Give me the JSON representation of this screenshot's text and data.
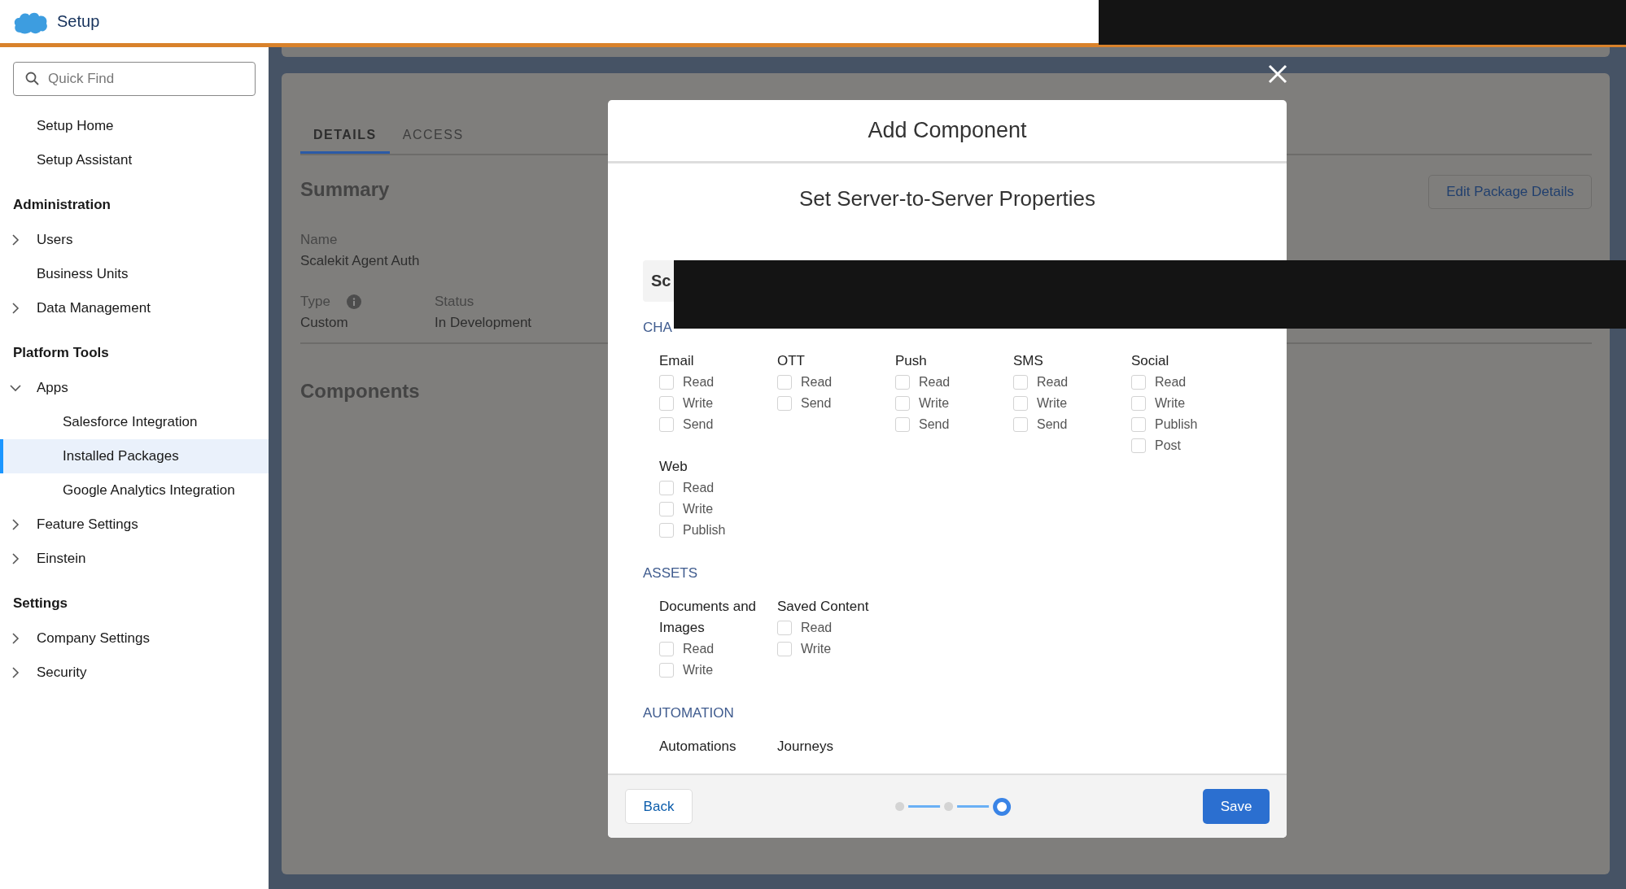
{
  "header": {
    "title": "Setup"
  },
  "sidebar": {
    "search": {
      "placeholder": "Quick Find"
    },
    "sections": [
      {
        "items": [
          {
            "label": "Setup Home",
            "kind": "leaf",
            "selected": false
          },
          {
            "label": "Setup Assistant",
            "kind": "leaf",
            "selected": false
          }
        ]
      },
      {
        "heading": "Administration",
        "items": [
          {
            "label": "Users",
            "kind": "folder",
            "expanded": false,
            "selected": false
          },
          {
            "label": "Business Units",
            "kind": "leaf",
            "selected": false
          },
          {
            "label": "Data Management",
            "kind": "folder",
            "expanded": false,
            "selected": false
          }
        ]
      },
      {
        "heading": "Platform Tools",
        "items": [
          {
            "label": "Apps",
            "kind": "folder",
            "expanded": true,
            "selected": false,
            "children": [
              {
                "label": "Salesforce Integration",
                "selected": false
              },
              {
                "label": "Installed Packages",
                "selected": true
              },
              {
                "label": "Google Analytics Integration",
                "selected": false
              }
            ]
          },
          {
            "label": "Feature Settings",
            "kind": "folder",
            "expanded": false,
            "selected": false
          },
          {
            "label": "Einstein",
            "kind": "folder",
            "expanded": false,
            "selected": false
          }
        ]
      },
      {
        "heading": "Settings",
        "items": [
          {
            "label": "Company Settings",
            "kind": "folder",
            "expanded": false,
            "selected": false
          },
          {
            "label": "Security",
            "kind": "folder",
            "expanded": false,
            "selected": false
          }
        ]
      }
    ]
  },
  "page": {
    "tabs": [
      {
        "label": "DETAILS",
        "selected": true
      },
      {
        "label": "ACCESS",
        "selected": false
      }
    ],
    "summary_heading": "Summary",
    "edit_button": "Edit Package Details",
    "name": {
      "label": "Name",
      "value": "Scalekit Agent Auth"
    },
    "type": {
      "label": "Type",
      "value": "Custom"
    },
    "status": {
      "label": "Status",
      "value": "In Development"
    },
    "components_heading": "Components"
  },
  "modal": {
    "title": "Add Component",
    "subtitle": "Set Server-to-Server Properties",
    "tab": "Sc",
    "sections": [
      {
        "label": "CHA",
        "groups": [
          {
            "title": "Email",
            "options": [
              {
                "label": "Read",
                "checked": false
              },
              {
                "label": "Write",
                "checked": false
              },
              {
                "label": "Send",
                "checked": false
              }
            ]
          },
          {
            "title": "OTT",
            "options": [
              {
                "label": "Read",
                "checked": false
              },
              {
                "label": "Send",
                "checked": false
              }
            ]
          },
          {
            "title": "Push",
            "options": [
              {
                "label": "Read",
                "checked": false
              },
              {
                "label": "Write",
                "checked": false
              },
              {
                "label": "Send",
                "checked": false
              }
            ]
          },
          {
            "title": "SMS",
            "options": [
              {
                "label": "Read",
                "checked": false
              },
              {
                "label": "Write",
                "checked": false
              },
              {
                "label": "Send",
                "checked": false
              }
            ]
          },
          {
            "title": "Social",
            "options": [
              {
                "label": "Read",
                "checked": false
              },
              {
                "label": "Write",
                "checked": false
              },
              {
                "label": "Publish",
                "checked": false
              },
              {
                "label": "Post",
                "checked": false
              }
            ]
          },
          {
            "title": "Web",
            "options": [
              {
                "label": "Read",
                "checked": false
              },
              {
                "label": "Write",
                "checked": false
              },
              {
                "label": "Publish",
                "checked": false
              }
            ]
          }
        ]
      },
      {
        "label": "ASSETS",
        "groups": [
          {
            "title": "Documents and Images",
            "options": [
              {
                "label": "Read",
                "checked": false
              },
              {
                "label": "Write",
                "checked": false
              }
            ]
          },
          {
            "title": "Saved Content",
            "options": [
              {
                "label": "Read",
                "checked": false
              },
              {
                "label": "Write",
                "checked": false
              }
            ]
          }
        ]
      },
      {
        "label": "AUTOMATION",
        "groups": [
          {
            "title": "Automations"
          },
          {
            "title": "Journeys"
          }
        ]
      }
    ],
    "back": "Back",
    "save": "Save",
    "steps": [
      {
        "selected": false
      },
      {
        "selected": false
      },
      {
        "selected": true
      }
    ]
  }
}
